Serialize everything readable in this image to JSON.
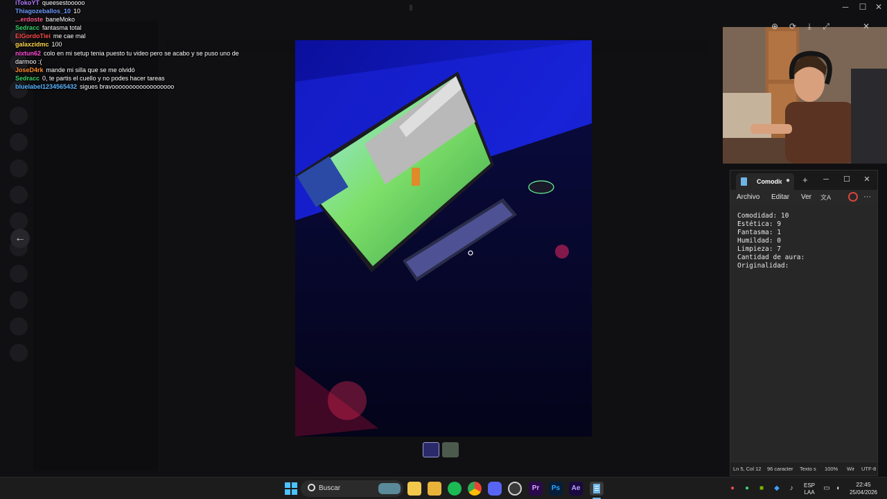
{
  "chat": [
    {
      "user": "iTokoYT",
      "color": "#b57bff",
      "msg": "queesestooooo"
    },
    {
      "user": "Thiagozeballos_10",
      "color": "#6e9bff",
      "msg": "10"
    },
    {
      "user": "...erdoste",
      "color": "#ff5a8a",
      "msg": "baneMoko"
    },
    {
      "user": "Sedracc",
      "color": "#39d36b",
      "msg": "fantasma total"
    },
    {
      "user": "ElGordoTiei",
      "color": "#ff4d4d",
      "msg": "me cae mal"
    },
    {
      "user": "galaxzidmc",
      "color": "#ffd54d",
      "msg": "100"
    },
    {
      "user": "nixtun62",
      "color": "#ff4fd8",
      "msg": "colo en mi setup tenia puesto tu video pero se acabo y se puso uno de darmoo :("
    },
    {
      "user": "JoseD4rk",
      "color": "#ff8c2e",
      "msg": "mande mi silla que se me olvidó"
    },
    {
      "user": "Sedracc",
      "color": "#39d36b",
      "msg": "0, te partis el cuello y no podes hacer tareas"
    },
    {
      "user": "bluelabel1234565432",
      "color": "#5ab4ff",
      "msg": "sigues bravoooooooooooooooooo"
    }
  ],
  "notepad": {
    "tab_title": "Comodid",
    "tab_dot": "●",
    "new_tab": "+",
    "minimize": "─",
    "maximize": "☐",
    "close": "✕",
    "menu": {
      "file": "Archivo",
      "edit": "Editar",
      "view": "Ver",
      "translate_icon": "文A",
      "more": "···"
    },
    "lines": [
      "Comodidad: 10",
      "Estética: 9",
      "Fantasma: 1",
      "Humildad: 0",
      "Limpieza: 7",
      "Cantidad de aura:",
      "Originalidad:"
    ],
    "status": {
      "position": "Ln 5, Col 12",
      "chars": "96 caracter",
      "format": "Texto s",
      "zoom": "100%",
      "eol": "Wir",
      "encoding": "UTF-8"
    }
  },
  "viewer": {
    "back_icon": "←"
  },
  "window_controls": {
    "minimize": "─",
    "maximize": "☐",
    "close": "✕"
  },
  "cam_tools": {
    "zoom_icon": "⊕",
    "rotate_icon": "⟳",
    "download_icon": "⤓",
    "expand_icon": "⤢",
    "close_icon": "✕"
  },
  "taskbar": {
    "search_placeholder": "Buscar",
    "language_top": "ESP",
    "language_bottom": "LAA",
    "time": "22:45",
    "date": "25/04/2026",
    "apps": [
      "windows-start",
      "search",
      "widgets",
      "file-explorer",
      "folder",
      "spotify",
      "chrome",
      "discord",
      "obs",
      "premiere",
      "photoshop",
      "after-effects",
      "notepad"
    ],
    "app_labels": {
      "premiere": "Pr",
      "photoshop": "Ps",
      "after_effects": "Ae"
    }
  },
  "colors": {
    "accent": "#6db6e7",
    "photo_blue": "#1a1fd0"
  }
}
